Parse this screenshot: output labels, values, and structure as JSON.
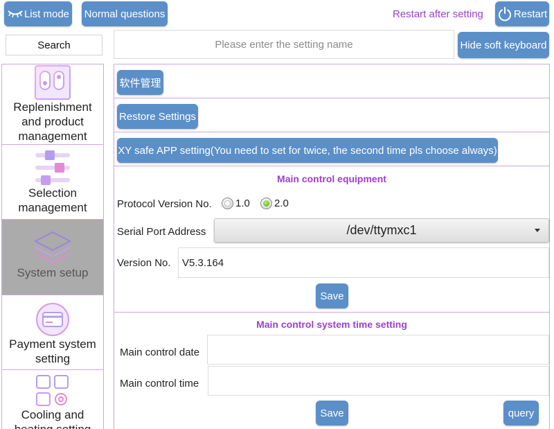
{
  "topbar": {
    "list_mode": "List mode",
    "normal_questions": "Normal questions",
    "restart_note": "Restart after setting",
    "restart": "Restart"
  },
  "search": {
    "label": "Search",
    "placeholder": "Please enter the setting name",
    "value": ""
  },
  "hide_keyboard": "Hide soft keyboard",
  "sidebar": {
    "items": [
      {
        "label": "Replenishment and product management",
        "icon": "vending-machine-icon",
        "active": false
      },
      {
        "label": "Selection management",
        "icon": "sliders-icon",
        "active": false
      },
      {
        "label": "System setup",
        "icon": "layers-icon",
        "active": true
      },
      {
        "label": "Payment system setting",
        "icon": "credit-card-icon",
        "active": false
      },
      {
        "label": "Cooling and heating setting",
        "icon": "grid-gear-icon",
        "active": false
      }
    ]
  },
  "content": {
    "software_management": "软件管理",
    "restore_settings": "Restore Settings",
    "xy_safe_app": "XY safe APP setting(You need to set for twice, the second time pls choose always)",
    "main_control": {
      "title": "Main control equipment",
      "protocol_label": "Protocol Version No.",
      "protocol_options": [
        "1.0",
        "2.0"
      ],
      "protocol_selected": "2.0",
      "serial_label": "Serial Port Address",
      "serial_value": "/dev/ttymxc1",
      "version_label": "Version No.",
      "version_value": "V5.3.164",
      "save": "Save"
    },
    "time_setting": {
      "title": "Main control system time setting",
      "date_label": "Main control date",
      "date_value": "",
      "time_label": "Main control time",
      "time_value": "",
      "save": "Save",
      "query": "query"
    }
  },
  "colors": {
    "button": "#5b8fc8",
    "accent_purple": "#9c3fd0",
    "border_lilac": "#c9a6e4",
    "active_item": "#ababab"
  }
}
